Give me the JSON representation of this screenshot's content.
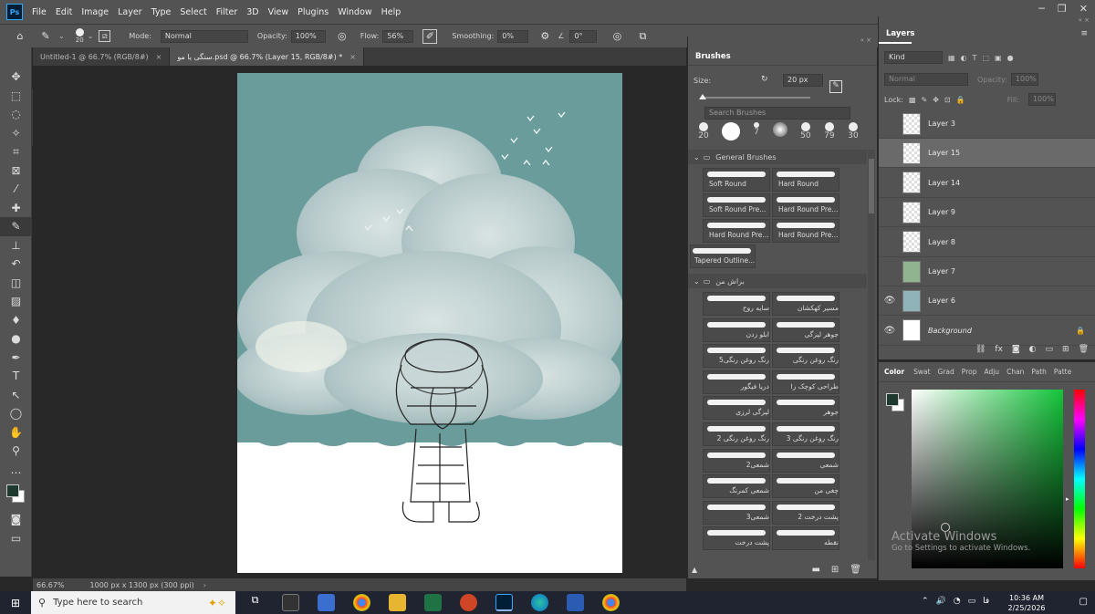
{
  "app": {
    "logo": "Ps",
    "menu": [
      "File",
      "Edit",
      "Image",
      "Layer",
      "Type",
      "Select",
      "Filter",
      "3D",
      "View",
      "Plugins",
      "Window",
      "Help"
    ]
  },
  "options": {
    "brush_size": "20",
    "mode_label": "Mode:",
    "mode_value": "Normal",
    "opacity_label": "Opacity:",
    "opacity_value": "100%",
    "flow_label": "Flow:",
    "flow_value": "56%",
    "smoothing_label": "Smoothing:",
    "smoothing_value": "0%",
    "angle_value": "0°"
  },
  "tabs": [
    {
      "label": "Untitled-1 @ 66.7% (RGB/8#)",
      "close": "×"
    },
    {
      "label": "سنگی یا مو.psd @ 66.7% (Layer 15, RGB/8#) *",
      "close": "×"
    }
  ],
  "status": {
    "zoom": "66.67%",
    "doc_size": "1000 px x 1300 px (300 ppi)"
  },
  "brushes": {
    "title": "Brushes",
    "size_label": "Size:",
    "size_value": "20 px",
    "search_placeholder": "Search Brushes",
    "recent_sizes": [
      "20",
      "",
      "7",
      "",
      "50",
      "79",
      "30"
    ],
    "general_folder": "General Brushes",
    "general_items": [
      "Soft Round",
      "Hard Round",
      "Soft Round Pre...",
      "Hard Round Pre...",
      "Hard Round Pre...",
      "Hard Round Pre..."
    ],
    "tapered": "Tapered Outline...",
    "custom_folder": "براش من",
    "custom_items": [
      "سایه روح",
      "مسیر کهکشان",
      "ابلو زدن",
      "جوهر لیزگی",
      "رنگ روغن رنگی5",
      "رنگ روغن رنگی",
      "دریا فیگور",
      "طراحی کوچک را",
      "لیزگی لرزی",
      "جوهر",
      "رنگ روغن رنگی 2",
      "رنگ روغن رنگی 3",
      "شمعی2",
      "شمعی",
      "شمعی کمرنگ",
      "چغی من",
      "شمعی3",
      "پشت درخت 2",
      "پشت درخت",
      "نقطه"
    ]
  },
  "layers": {
    "title": "Layers",
    "kind": "Kind",
    "blend": "Normal",
    "opacity_label": "Opacity:",
    "opacity_value": "100%",
    "lock_label": "Lock:",
    "fill_label": "Fill:",
    "fill_value": "100%",
    "items": [
      {
        "name": "Layer 3",
        "visible": false
      },
      {
        "name": "Layer 15",
        "visible": false,
        "selected": true
      },
      {
        "name": "Layer 14",
        "visible": false
      },
      {
        "name": "Layer 9",
        "visible": false
      },
      {
        "name": "Layer 8",
        "visible": false
      },
      {
        "name": "Layer 7",
        "visible": false
      },
      {
        "name": "Layer 6",
        "visible": true
      },
      {
        "name": "Background",
        "visible": true,
        "locked": true
      }
    ]
  },
  "color_panel": {
    "tabs": [
      "Color",
      "Swat",
      "Grad",
      "Prop",
      "Adju",
      "Chan",
      "Path",
      "Patte"
    ]
  },
  "watermark": {
    "title": "Activate Windows",
    "subtitle": "Go to Settings to activate Windows."
  },
  "taskbar": {
    "search_placeholder": "Type here to search",
    "language": "فا",
    "time": "10:36 AM",
    "date": "2/25/2026"
  }
}
